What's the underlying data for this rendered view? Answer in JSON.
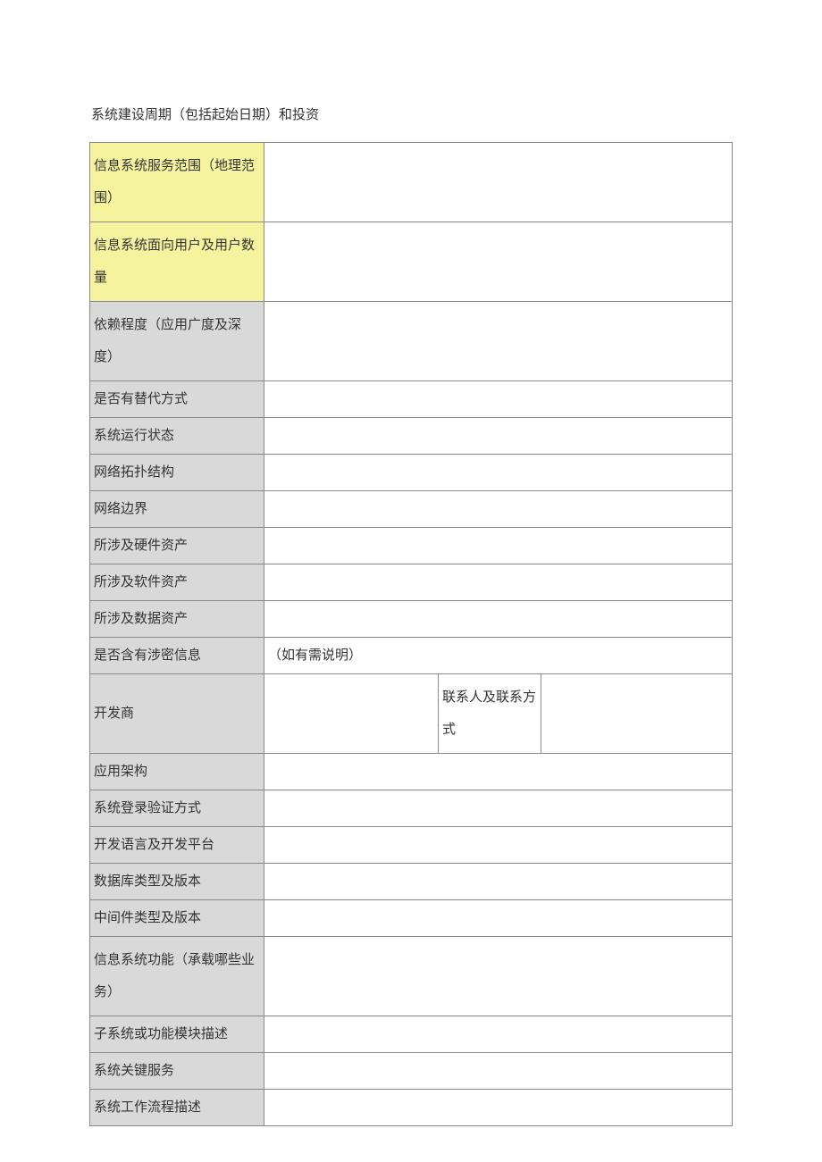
{
  "leadText": "系统建设周期（包括起始日期）和投资",
  "rows": [
    {
      "label": "信息系统服务范围（地理范围）",
      "highlight": true,
      "multiline": true,
      "value": ""
    },
    {
      "label": "信息系统面向用户及用户数量",
      "highlight": true,
      "multiline": true,
      "value": ""
    },
    {
      "label": "依赖程度（应用广度及深度）",
      "highlight": false,
      "multiline": true,
      "value": ""
    },
    {
      "label": "是否有替代方式",
      "highlight": false,
      "multiline": false,
      "value": ""
    },
    {
      "label": "系统运行状态",
      "highlight": false,
      "multiline": false,
      "value": ""
    },
    {
      "label": "网络拓扑结构",
      "highlight": false,
      "multiline": false,
      "value": ""
    },
    {
      "label": "网络边界",
      "highlight": false,
      "multiline": false,
      "value": ""
    },
    {
      "label": "所涉及硬件资产",
      "highlight": false,
      "multiline": false,
      "value": ""
    },
    {
      "label": "所涉及软件资产",
      "highlight": false,
      "multiline": false,
      "value": ""
    },
    {
      "label": "所涉及数据资产",
      "highlight": false,
      "multiline": false,
      "value": ""
    }
  ],
  "confidentialRow": {
    "label": "是否含有涉密信息",
    "value": "（如有需说明）"
  },
  "developerRow": {
    "label": "开发商",
    "value1": "",
    "contactLabel": "联系人及联系方式",
    "contactValue": ""
  },
  "rows2": [
    {
      "label": "应用架构",
      "value": ""
    },
    {
      "label": "系统登录验证方式",
      "value": ""
    },
    {
      "label": "开发语言及开发平台",
      "value": ""
    },
    {
      "label": "数据库类型及版本",
      "value": ""
    },
    {
      "label": "中间件类型及版本",
      "value": ""
    },
    {
      "label": "信息系统功能（承载哪些业务）",
      "multiline": true,
      "value": ""
    },
    {
      "label": "子系统或功能模块描述",
      "value": ""
    },
    {
      "label": "系统关键服务",
      "value": ""
    },
    {
      "label": "系统工作流程描述",
      "value": ""
    }
  ]
}
